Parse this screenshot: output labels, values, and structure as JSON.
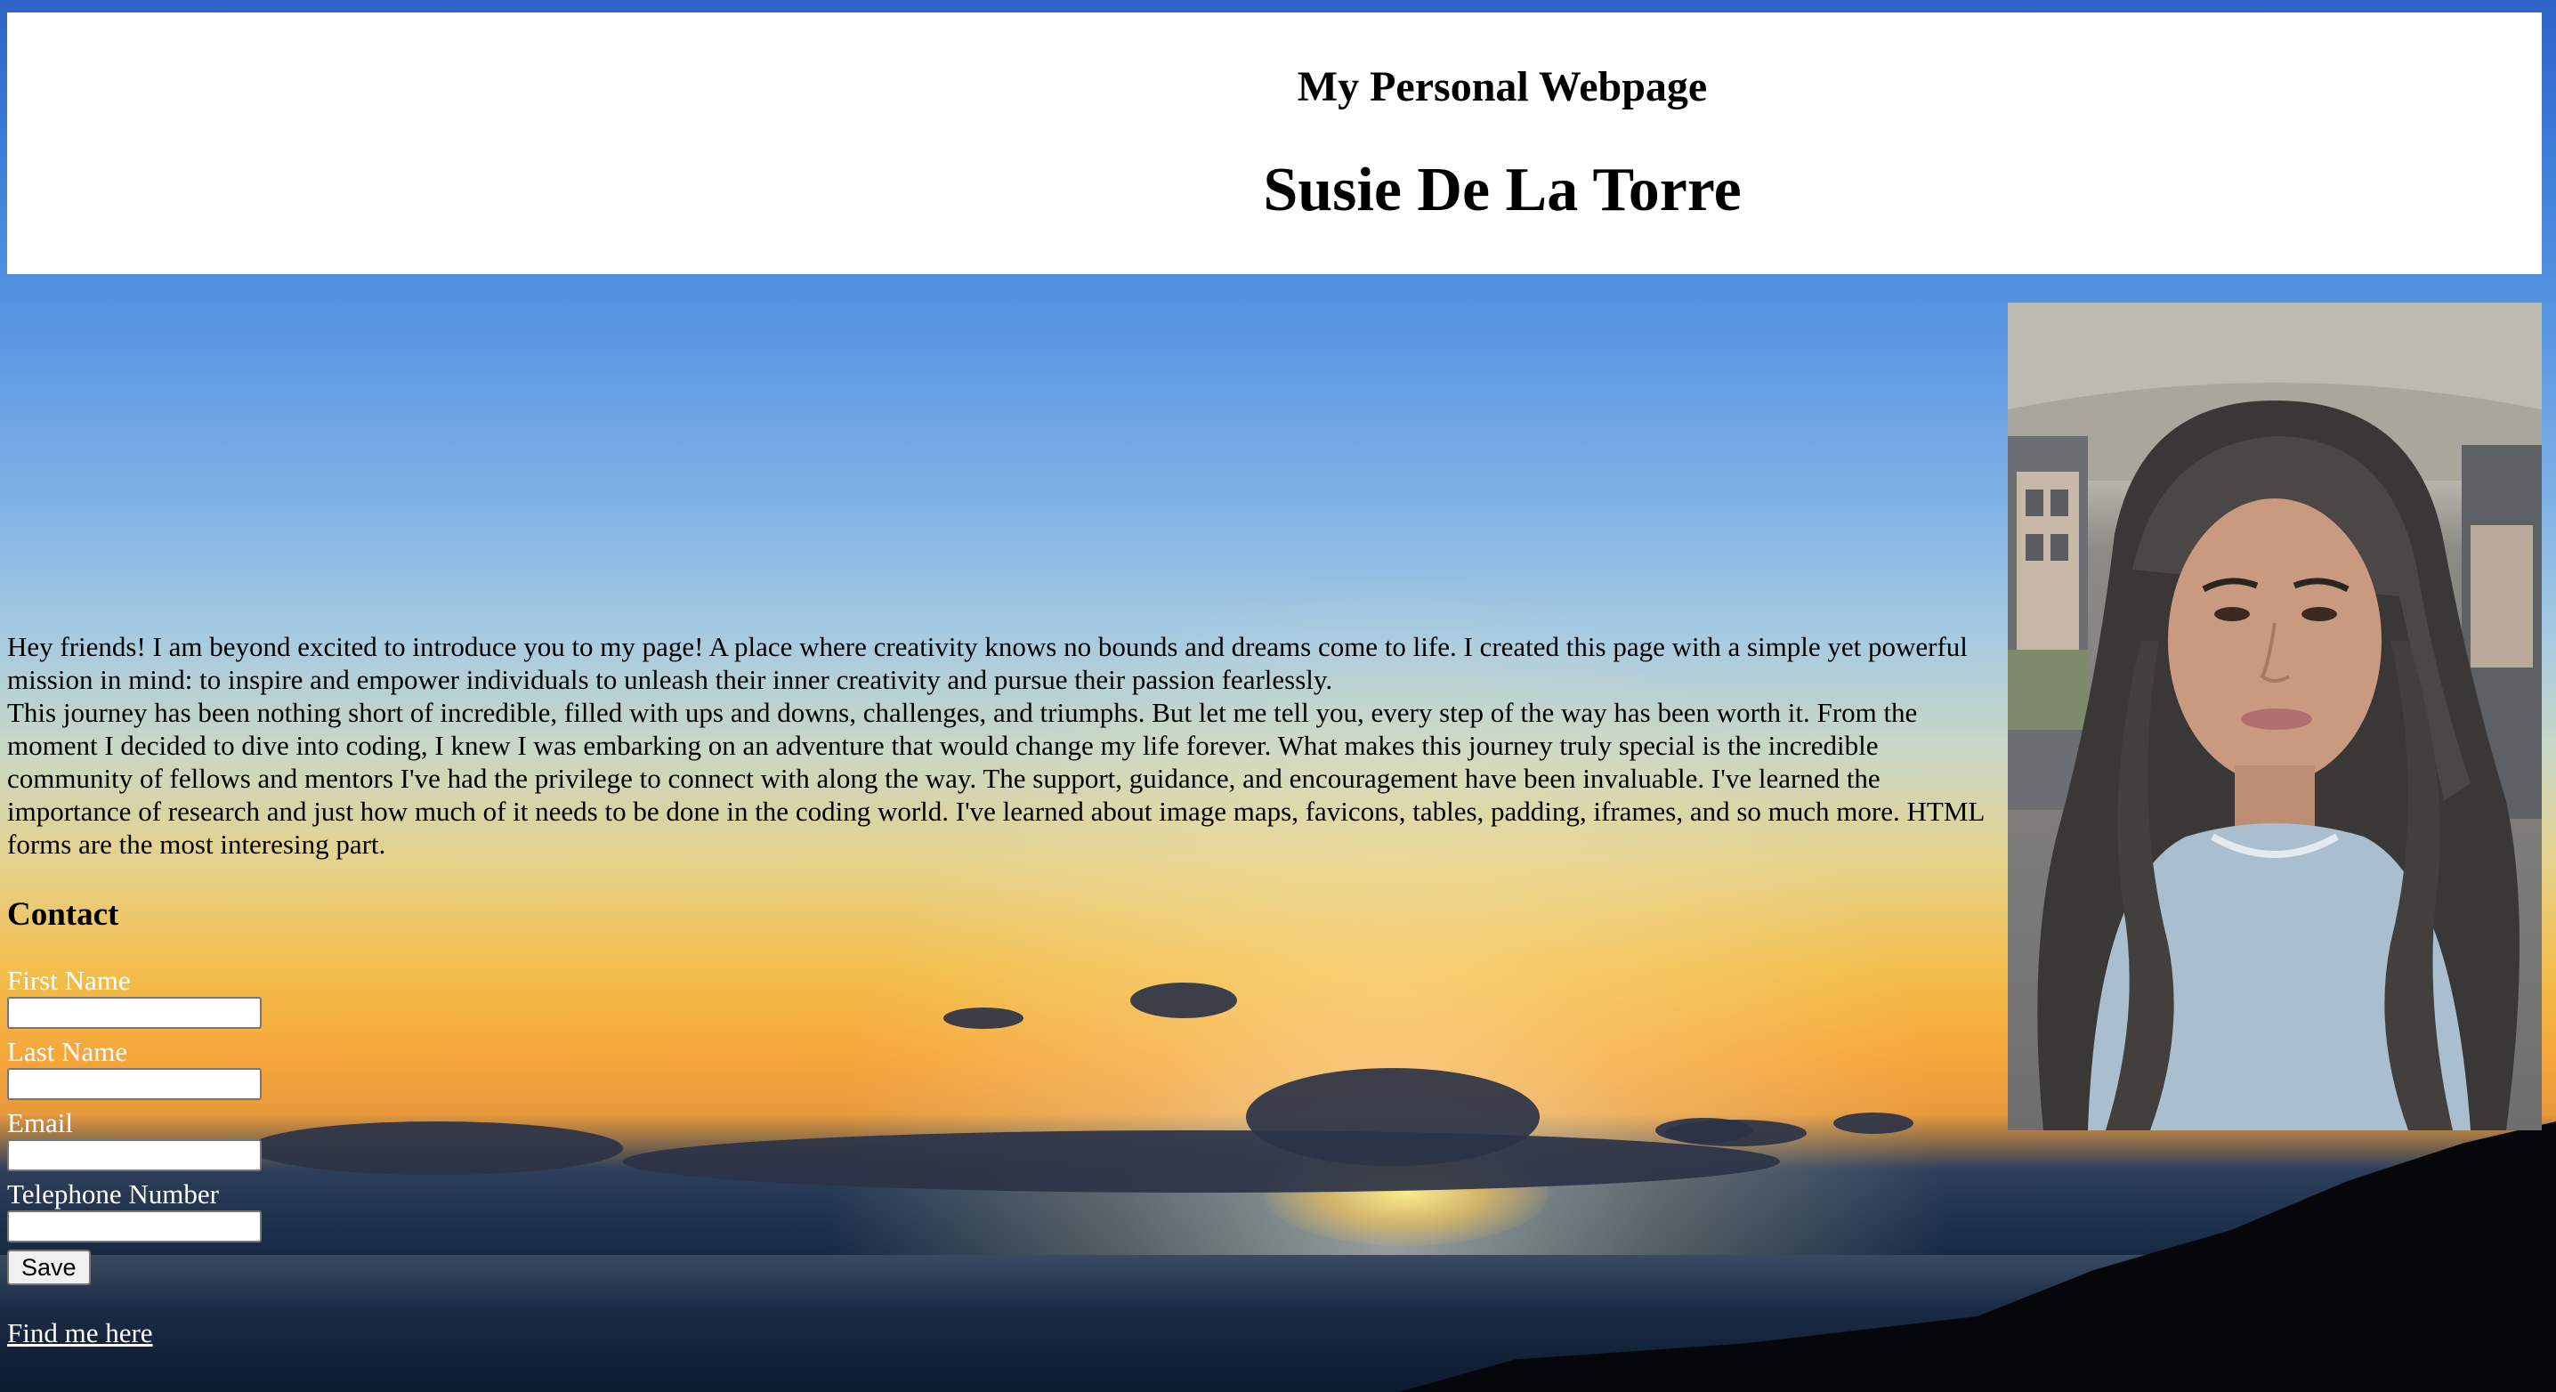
{
  "header": {
    "subtitle": "My Personal Webpage",
    "name": "Susie De La Torre"
  },
  "intro": {
    "paragraph1": "Hey friends! I am beyond excited to introduce you to my page! A place where creativity knows no bounds and dreams come to life. I created this page with a simple yet powerful mission in mind: to inspire and empower individuals to unleash their inner creativity and pursue their passion fearlessly.",
    "paragraph2": "This journey has been nothing short of incredible, filled with ups and downs, challenges, and triumphs. But let me tell you, every step of the way has been worth it. From the moment I decided to dive into coding, I knew I was embarking on an adventure that would change my life forever. What makes this journey truly special is the incredible community of fellows and mentors I've had the privilege to connect with along the way. The support, guidance, and encouragement have been invaluable. I've learned the importance of research and just how much of it needs to be done in the coding world. I've learned about image maps, favicons, tables, padding, iframes, and so much more. HTML forms are the most interesing part."
  },
  "contact": {
    "title": "Contact",
    "fields": [
      {
        "label": "First Name",
        "value": ""
      },
      {
        "label": "Last Name",
        "value": ""
      },
      {
        "label": "Email",
        "value": ""
      },
      {
        "label": "Telephone Number",
        "value": ""
      }
    ],
    "save_label": "Save"
  },
  "link": {
    "text": "Find me here"
  },
  "colors": {
    "sky_top": "#2f62c8",
    "sunset": "#f3bd4a",
    "sea": "#0e1a2e",
    "header_bg": "#ffffff"
  }
}
